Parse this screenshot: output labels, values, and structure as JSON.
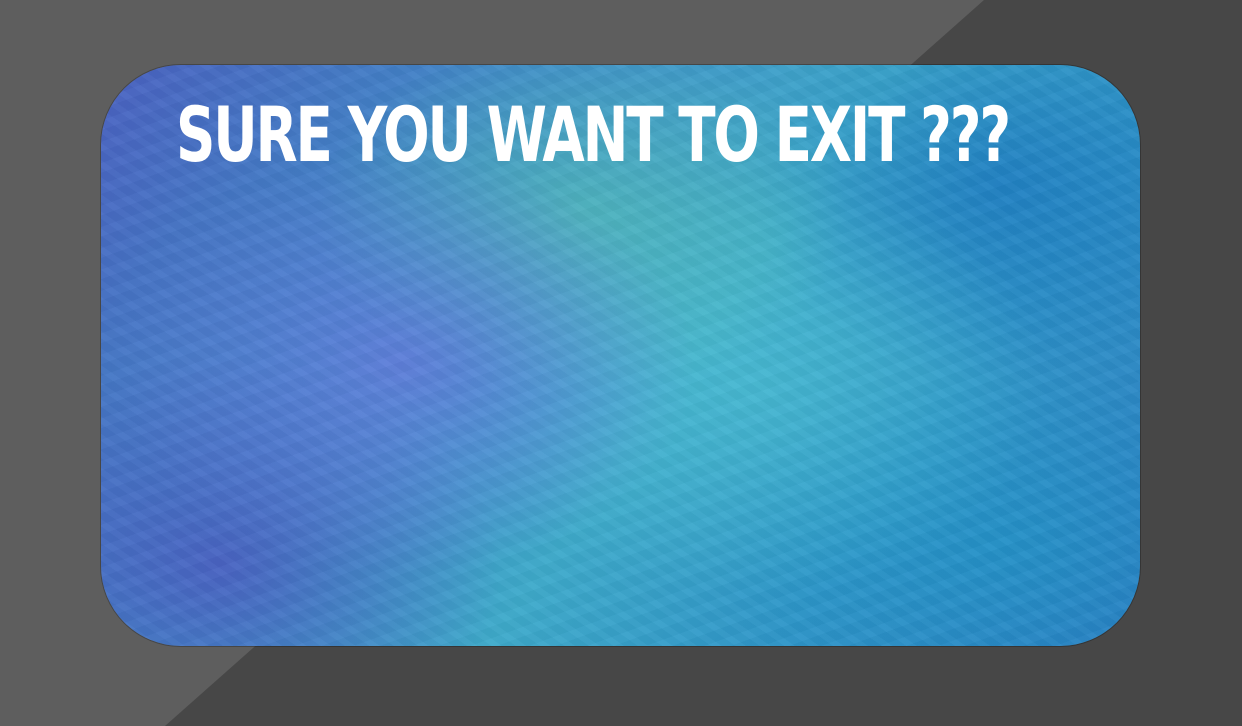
{
  "dialog": {
    "title": "SURE YOU WANT TO EXIT ???"
  },
  "colors": {
    "backdrop_dark": "#474747",
    "backdrop_light": "#5e5e5e",
    "panel_blue": "#3f8cc9",
    "panel_teal": "#3eaacb",
    "panel_violet": "#4a61c2",
    "title_text": "#ffffff"
  }
}
